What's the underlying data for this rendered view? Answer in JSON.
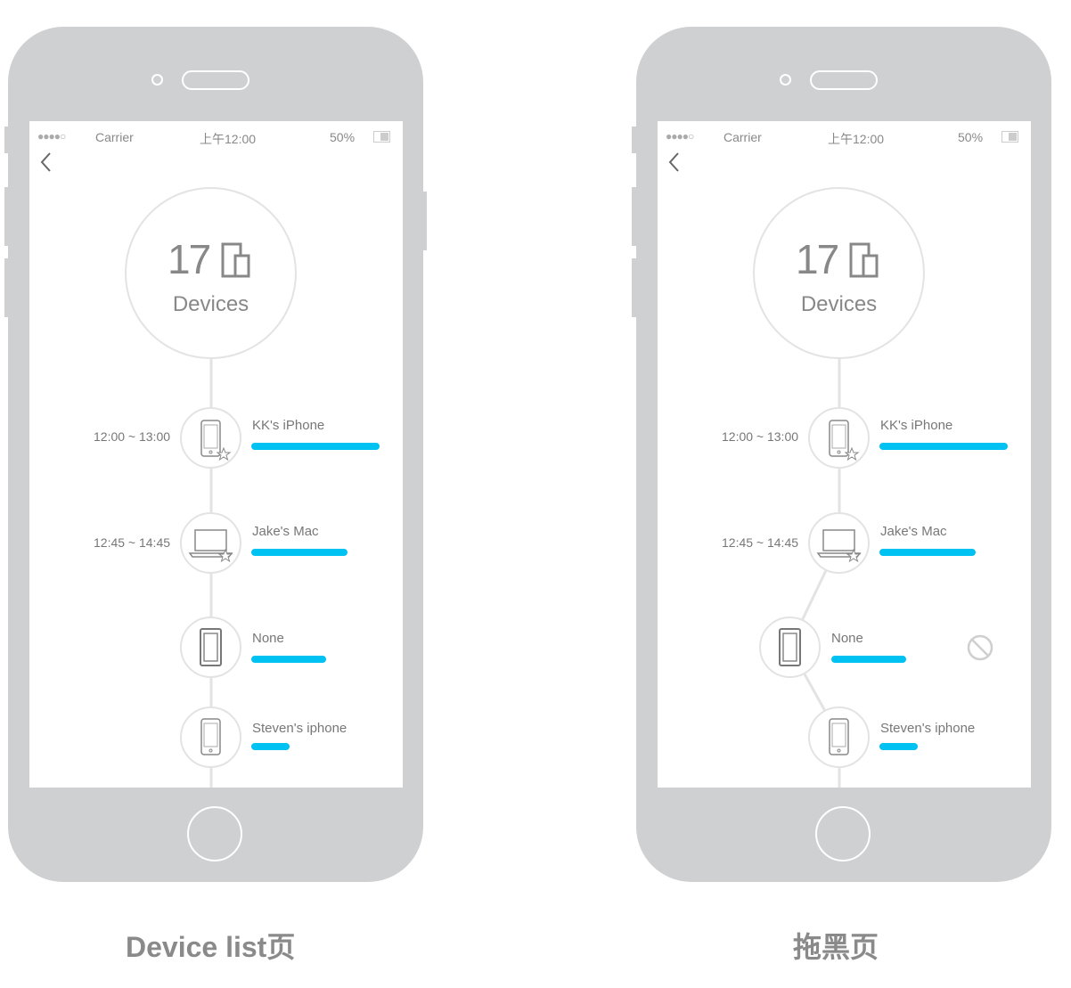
{
  "status_bar": {
    "signal": "●●●●○",
    "carrier": "Carrier",
    "time": "上午12:00",
    "battery": "50%"
  },
  "hub": {
    "count": "17",
    "label": "Devices"
  },
  "devices": [
    {
      "name": "KK's iPhone",
      "time": "12:00 ~ 13:00",
      "icon": "phone-star-icon",
      "usage": 1.0
    },
    {
      "name": "Jake's Mac",
      "time": "12:45 ~ 14:45",
      "icon": "laptop-star-icon",
      "usage": 0.75
    },
    {
      "name": "None",
      "time": "",
      "icon": "tablet-icon",
      "usage": 0.58
    },
    {
      "name": "Steven's iphone",
      "time": "",
      "icon": "phone-icon",
      "usage": 0.3
    }
  ],
  "captions": {
    "left": "Device list页",
    "right": "拖黑页"
  },
  "colors": {
    "accent": "#00c2f2",
    "frame": "#cfd0d2"
  }
}
